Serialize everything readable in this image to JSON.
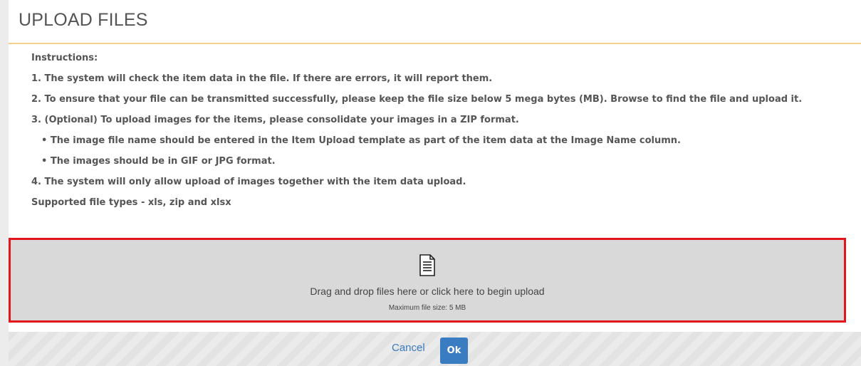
{
  "header": {
    "title": "UPLOAD FILES"
  },
  "instructions": {
    "heading": "Instructions:",
    "lines": [
      "1. The system will check the item data in the file. If there are errors, it will report them.",
      "2. To ensure that your file can be transmitted successfully, please keep the file size below 5 mega bytes (MB). Browse to find the file and upload it.",
      "3. (Optional) To upload images for the items, please consolidate your images in a ZIP format.",
      "• The image file name should be entered in the Item Upload template as part of the item data at the Image Name column.",
      "• The images should be in GIF or JPG format.",
      "4. The system will only allow upload of images together with the item data upload.",
      "Supported file types - xls, zip and xlsx"
    ]
  },
  "dropzone": {
    "icon": "document-icon",
    "main_text": "Drag and drop files here or click here to begin upload",
    "sub_text": "Maximum file size: 5 MB",
    "highlight_color": "#e3161e"
  },
  "footer": {
    "cancel_label": "Cancel",
    "ok_label": "Ok",
    "accent_color": "#3a7cc2"
  }
}
